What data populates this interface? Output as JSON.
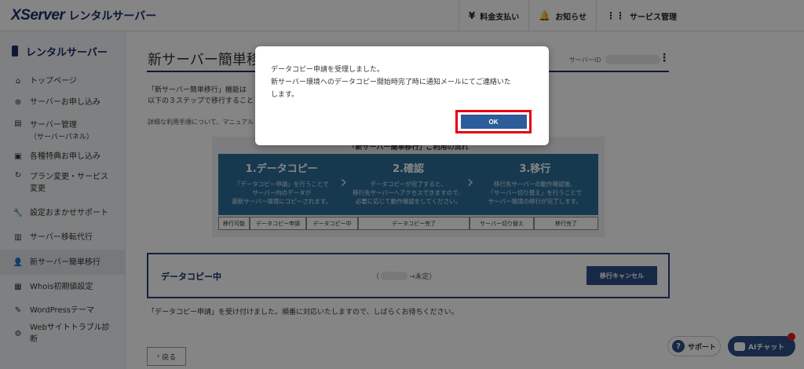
{
  "header": {
    "brand": "XServer",
    "product": "レンタルサーバー",
    "nav": [
      {
        "icon": "yen-icon",
        "label": "料金支払い"
      },
      {
        "icon": "bell-icon",
        "label": "お知らせ"
      },
      {
        "icon": "grid-icon",
        "label": "サービス管理"
      }
    ]
  },
  "sidebar": {
    "title": "レンタルサーバー",
    "items": [
      {
        "icon": "home-icon",
        "label": "トップページ"
      },
      {
        "icon": "plus-circle-icon",
        "label": "サーバーお申し込み"
      },
      {
        "icon": "server-icon",
        "label": "サーバー管理",
        "sub": "（サーバーパネル）"
      },
      {
        "icon": "gift-icon",
        "label": "各種特典お申し込み"
      },
      {
        "icon": "refresh-icon",
        "label": "プラン変更・サービス変更"
      },
      {
        "icon": "wrench-icon",
        "label": "設定おまかせサポート"
      },
      {
        "icon": "server-move-icon",
        "label": "サーバー移転代行"
      },
      {
        "icon": "person-icon",
        "label": "新サーバー簡単移行"
      },
      {
        "icon": "whois-icon",
        "label": "Whois初期値設定"
      },
      {
        "icon": "wordpress-icon",
        "label": "WordPressテーマ"
      },
      {
        "icon": "trouble-icon",
        "label": "Webサイトトラブル診断"
      }
    ]
  },
  "main": {
    "title": "新サーバー簡単移行",
    "server_id_label": "サーバーID",
    "intro_line1": "「新サーバー簡単移行」機能は",
    "intro_line2": "以下の３ステップで移行すること",
    "intro_note": "詳細な利用手順について、マニュアル",
    "flow_title": "「新サーバー簡単移行」ご利用の流れ",
    "steps": [
      {
        "name": "1.データコピー",
        "desc1": "「データコピー申請」を行うことで",
        "desc2": "サーバー内のデータが",
        "desc3": "最新サーバー環境にコピーされます。"
      },
      {
        "name": "2.確認",
        "desc1": "データコピーが完了すると、",
        "desc2": "移行先サーバーへアクセスできますので、",
        "desc3": "必要に応じて動作確認をしてください。"
      },
      {
        "name": "3.移行",
        "desc1": "移行先サーバーの動作確認後、",
        "desc2": "「サーバー切り替え」を行うことで",
        "desc3": "サーバー環境の移行が完了します。"
      }
    ],
    "status_bar": [
      "移行可能",
      "データコピー申請",
      "データコピー中",
      "データコピー完了",
      "サーバー切り替え",
      "移行完了"
    ],
    "progress_title": "データコピー中",
    "progress_status_open": "（",
    "progress_status_rest": "→未定）",
    "cancel_label": "移行キャンセル",
    "note": "「データコピー申請」を受け付けました。順番に対応いたしますので、しばらくお待ちください。",
    "back_label": "戻る"
  },
  "floating": {
    "support_label": "サポート",
    "ai_label": "AIチャット"
  },
  "dialog": {
    "line1": "データコピー申請を受理しました。",
    "line2": "新サーバー環境へのデータコピー開始時完了時に通知メールにてご連絡いた",
    "line3": "します。",
    "ok_label": "OK"
  }
}
